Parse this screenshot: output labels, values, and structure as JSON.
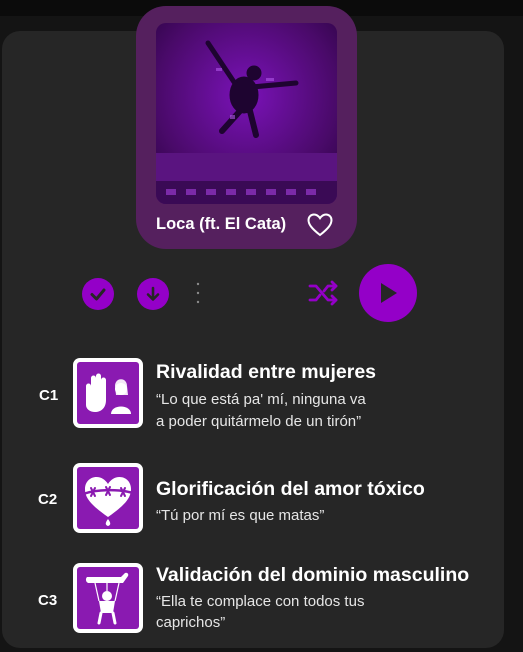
{
  "player": {
    "song_title": "Loca (ft. El Cata)",
    "cover_icon": "album-cover-image",
    "liked": false,
    "accent_color": "#9400c8"
  },
  "controls": {
    "icons": [
      "check-circle-icon",
      "download-circle-icon",
      "more-vertical-icon",
      "shuffle-icon",
      "play-icon"
    ]
  },
  "categories": [
    {
      "code": "C1",
      "title": "Rivalidad entre mujeres",
      "quote_line1": "“Lo que está pa' mí, ninguna va",
      "quote_line2": "a poder quitármelo de un tirón”",
      "icon": "rivalry-icon"
    },
    {
      "code": "C2",
      "title": "Glorificación del amor tóxico",
      "quote_line1": "“Tú por mí es que matas”",
      "icon": "barbed-heart-icon"
    },
    {
      "code": "C3",
      "title": "Validación del dominio masculino",
      "quote_line1": "“Ella te complace con todos tus caprichos”",
      "icon": "puppet-icon"
    }
  ]
}
